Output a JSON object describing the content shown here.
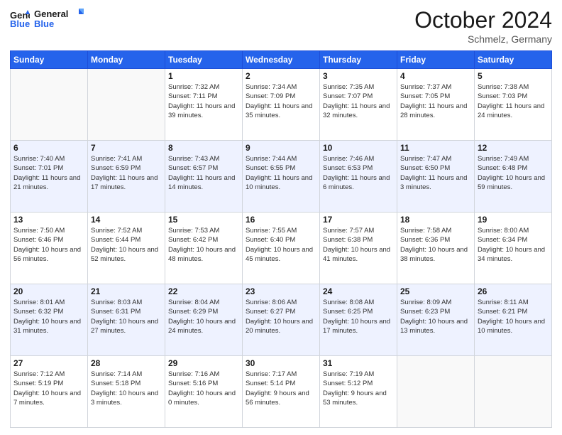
{
  "logo": {
    "line1": "General",
    "line2": "Blue"
  },
  "header": {
    "month": "October 2024",
    "location": "Schmelz, Germany"
  },
  "weekdays": [
    "Sunday",
    "Monday",
    "Tuesday",
    "Wednesday",
    "Thursday",
    "Friday",
    "Saturday"
  ],
  "weeks": [
    [
      {
        "day": "",
        "info": ""
      },
      {
        "day": "",
        "info": ""
      },
      {
        "day": "1",
        "info": "Sunrise: 7:32 AM\nSunset: 7:11 PM\nDaylight: 11 hours and 39 minutes."
      },
      {
        "day": "2",
        "info": "Sunrise: 7:34 AM\nSunset: 7:09 PM\nDaylight: 11 hours and 35 minutes."
      },
      {
        "day": "3",
        "info": "Sunrise: 7:35 AM\nSunset: 7:07 PM\nDaylight: 11 hours and 32 minutes."
      },
      {
        "day": "4",
        "info": "Sunrise: 7:37 AM\nSunset: 7:05 PM\nDaylight: 11 hours and 28 minutes."
      },
      {
        "day": "5",
        "info": "Sunrise: 7:38 AM\nSunset: 7:03 PM\nDaylight: 11 hours and 24 minutes."
      }
    ],
    [
      {
        "day": "6",
        "info": "Sunrise: 7:40 AM\nSunset: 7:01 PM\nDaylight: 11 hours and 21 minutes."
      },
      {
        "day": "7",
        "info": "Sunrise: 7:41 AM\nSunset: 6:59 PM\nDaylight: 11 hours and 17 minutes."
      },
      {
        "day": "8",
        "info": "Sunrise: 7:43 AM\nSunset: 6:57 PM\nDaylight: 11 hours and 14 minutes."
      },
      {
        "day": "9",
        "info": "Sunrise: 7:44 AM\nSunset: 6:55 PM\nDaylight: 11 hours and 10 minutes."
      },
      {
        "day": "10",
        "info": "Sunrise: 7:46 AM\nSunset: 6:53 PM\nDaylight: 11 hours and 6 minutes."
      },
      {
        "day": "11",
        "info": "Sunrise: 7:47 AM\nSunset: 6:50 PM\nDaylight: 11 hours and 3 minutes."
      },
      {
        "day": "12",
        "info": "Sunrise: 7:49 AM\nSunset: 6:48 PM\nDaylight: 10 hours and 59 minutes."
      }
    ],
    [
      {
        "day": "13",
        "info": "Sunrise: 7:50 AM\nSunset: 6:46 PM\nDaylight: 10 hours and 56 minutes."
      },
      {
        "day": "14",
        "info": "Sunrise: 7:52 AM\nSunset: 6:44 PM\nDaylight: 10 hours and 52 minutes."
      },
      {
        "day": "15",
        "info": "Sunrise: 7:53 AM\nSunset: 6:42 PM\nDaylight: 10 hours and 48 minutes."
      },
      {
        "day": "16",
        "info": "Sunrise: 7:55 AM\nSunset: 6:40 PM\nDaylight: 10 hours and 45 minutes."
      },
      {
        "day": "17",
        "info": "Sunrise: 7:57 AM\nSunset: 6:38 PM\nDaylight: 10 hours and 41 minutes."
      },
      {
        "day": "18",
        "info": "Sunrise: 7:58 AM\nSunset: 6:36 PM\nDaylight: 10 hours and 38 minutes."
      },
      {
        "day": "19",
        "info": "Sunrise: 8:00 AM\nSunset: 6:34 PM\nDaylight: 10 hours and 34 minutes."
      }
    ],
    [
      {
        "day": "20",
        "info": "Sunrise: 8:01 AM\nSunset: 6:32 PM\nDaylight: 10 hours and 31 minutes."
      },
      {
        "day": "21",
        "info": "Sunrise: 8:03 AM\nSunset: 6:31 PM\nDaylight: 10 hours and 27 minutes."
      },
      {
        "day": "22",
        "info": "Sunrise: 8:04 AM\nSunset: 6:29 PM\nDaylight: 10 hours and 24 minutes."
      },
      {
        "day": "23",
        "info": "Sunrise: 8:06 AM\nSunset: 6:27 PM\nDaylight: 10 hours and 20 minutes."
      },
      {
        "day": "24",
        "info": "Sunrise: 8:08 AM\nSunset: 6:25 PM\nDaylight: 10 hours and 17 minutes."
      },
      {
        "day": "25",
        "info": "Sunrise: 8:09 AM\nSunset: 6:23 PM\nDaylight: 10 hours and 13 minutes."
      },
      {
        "day": "26",
        "info": "Sunrise: 8:11 AM\nSunset: 6:21 PM\nDaylight: 10 hours and 10 minutes."
      }
    ],
    [
      {
        "day": "27",
        "info": "Sunrise: 7:12 AM\nSunset: 5:19 PM\nDaylight: 10 hours and 7 minutes."
      },
      {
        "day": "28",
        "info": "Sunrise: 7:14 AM\nSunset: 5:18 PM\nDaylight: 10 hours and 3 minutes."
      },
      {
        "day": "29",
        "info": "Sunrise: 7:16 AM\nSunset: 5:16 PM\nDaylight: 10 hours and 0 minutes."
      },
      {
        "day": "30",
        "info": "Sunrise: 7:17 AM\nSunset: 5:14 PM\nDaylight: 9 hours and 56 minutes."
      },
      {
        "day": "31",
        "info": "Sunrise: 7:19 AM\nSunset: 5:12 PM\nDaylight: 9 hours and 53 minutes."
      },
      {
        "day": "",
        "info": ""
      },
      {
        "day": "",
        "info": ""
      }
    ]
  ]
}
